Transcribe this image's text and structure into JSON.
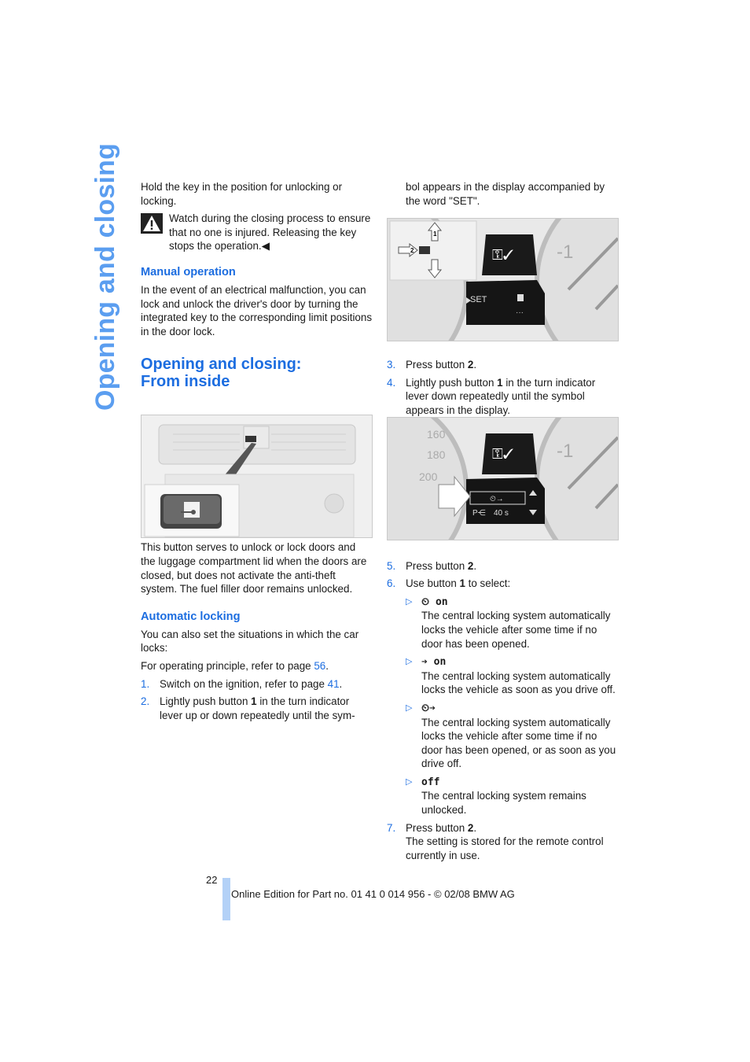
{
  "side_title": "Opening and closing",
  "left_column": {
    "intro": "Hold the key in the position for unlocking or locking.",
    "warning": {
      "icon": "warning-triangle-icon",
      "text": "Watch during the closing process to ensure that no one is injured. Releasing the key stops the operation.",
      "end_mark": "◀"
    },
    "manual_operation": {
      "heading": "Manual operation",
      "text": "In the event of an electrical malfunction, you can lock and unlock the driver's door by turning the integrated key to the corresponding limit positions in the door lock."
    },
    "section_heading_line1": "Opening and closing:",
    "section_heading_line2": "From inside",
    "figure_vents": {
      "alt": "Center console with door lock button"
    },
    "button_description": "This button serves to unlock or lock doors and the luggage compartment lid when the doors are closed, but does not activate the anti-theft system. The fuel filler door remains unlocked.",
    "automatic_locking": {
      "heading": "Automatic locking",
      "text": "You can also set the situations in which the car locks:",
      "operating_prefix": "For operating principle, refer to page ",
      "operating_page": "56",
      "operating_suffix": "."
    },
    "steps": [
      {
        "num": "1.",
        "text": "Switch on the ignition, refer to page ",
        "link": "41",
        "suffix": "."
      },
      {
        "num": "2.",
        "pre": "Lightly push button ",
        "bold": "1",
        "post": " in the turn indicator lever up or down repeatedly until the sym-"
      }
    ]
  },
  "right_column": {
    "continued": "bol appears in the display accompanied by the word \"SET\".",
    "figure1": {
      "display_text": "SET",
      "callout_1": "1",
      "callout_2": "2"
    },
    "steps_a": [
      {
        "num": "3.",
        "pre": "Press button ",
        "bold": "2",
        "post": "."
      },
      {
        "num": "4.",
        "pre": "Lightly push button ",
        "bold": "1",
        "post": " in the turn indicator lever down repeatedly until the symbol appears in the display."
      }
    ],
    "figure2": {
      "time_value": "40 s",
      "speeds": [
        "160",
        "180",
        "200"
      ]
    },
    "steps_b": [
      {
        "num": "5.",
        "pre": "Press button ",
        "bold": "2",
        "post": "."
      },
      {
        "num": "6.",
        "pre": "Use button ",
        "bold": "1",
        "post": " to select:"
      }
    ],
    "options": [
      {
        "symbol": "⏲ on",
        "text": "The central locking system automatically locks the vehicle after some time if no door has been opened."
      },
      {
        "symbol": "➔ on",
        "text": "The central locking system automatically locks the vehicle as soon as you drive off."
      },
      {
        "symbol": "⏲➔",
        "text": "The central locking system automatically locks the vehicle after some time if no door has been opened, or as soon as you drive off."
      },
      {
        "symbol": "off",
        "text": "The central locking system remains unlocked."
      }
    ],
    "step7": {
      "num": "7.",
      "pre": "Press button ",
      "bold": "2",
      "post": ".",
      "note": "The setting is stored for the remote control currently in use."
    }
  },
  "footer": {
    "page_number": "22",
    "edition": "Online Edition for Part no. 01 41 0 014 956 - © 02/08 BMW AG"
  }
}
